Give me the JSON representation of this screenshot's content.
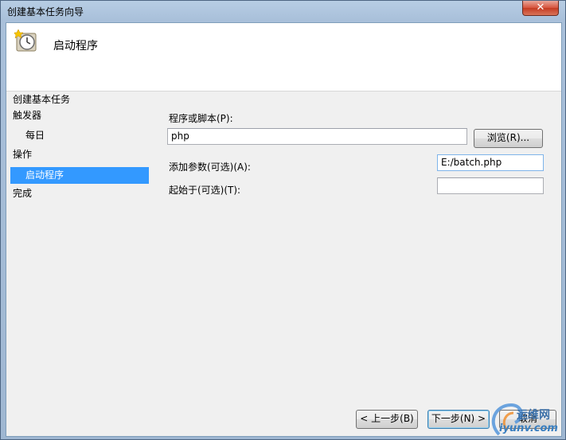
{
  "window": {
    "title": "创建基本任务向导",
    "close_label": "✕"
  },
  "header": {
    "title": "启动程序"
  },
  "steps": {
    "section_title": "创建基本任务",
    "items": [
      {
        "label": "触发器"
      },
      {
        "label": "每日"
      },
      {
        "label": "操作"
      },
      {
        "label": "启动程序"
      },
      {
        "label": "完成"
      }
    ]
  },
  "form": {
    "program_label": "程序或脚本(P):",
    "program_value": "php",
    "browse_label": "浏览(R)...",
    "args_label": "添加参数(可选)(A):",
    "args_value": "E:/batch.php",
    "startin_label": "起始于(可选)(T):",
    "startin_value": ""
  },
  "buttons": {
    "back_label": "< 上一步(B)",
    "next_label": "下一步(N) >",
    "cancel_label": "取消"
  },
  "watermark": {
    "cn": "运维网",
    "en": "iyunv.com"
  }
}
